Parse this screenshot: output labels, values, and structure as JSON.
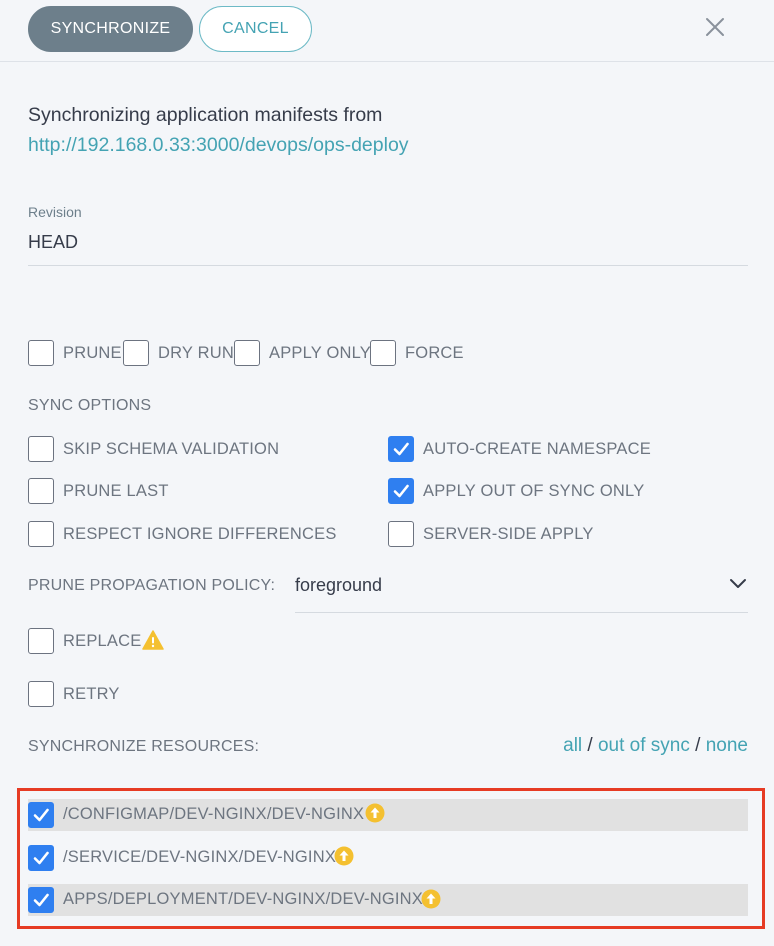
{
  "toolbar": {
    "synchronize_label": "SYNCHRONIZE",
    "cancel_label": "CANCEL",
    "close_icon": "close-icon"
  },
  "intro": {
    "text": "Synchronizing application manifests from",
    "repo_url": "http://192.168.0.33:3000/devops/ops-deploy"
  },
  "revision": {
    "label": "Revision",
    "value": "HEAD"
  },
  "options": {
    "prune": {
      "label": "PRUNE",
      "checked": false
    },
    "dry_run": {
      "label": "DRY RUN",
      "checked": false
    },
    "apply_only": {
      "label": "APPLY ONLY",
      "checked": false
    },
    "force": {
      "label": "FORCE",
      "checked": false
    }
  },
  "sync_options": {
    "title": "SYNC OPTIONS",
    "skip_schema_validation": {
      "label": "SKIP SCHEMA VALIDATION",
      "checked": false
    },
    "auto_create_namespace": {
      "label": "AUTO-CREATE NAMESPACE",
      "checked": true
    },
    "prune_last": {
      "label": "PRUNE LAST",
      "checked": false
    },
    "apply_out_of_sync_only": {
      "label": "APPLY OUT OF SYNC ONLY",
      "checked": true
    },
    "respect_ignore_differences": {
      "label": "RESPECT IGNORE DIFFERENCES",
      "checked": false
    },
    "server_side_apply": {
      "label": "SERVER-SIDE APPLY",
      "checked": false
    }
  },
  "prune_propagation": {
    "label": "PRUNE PROPAGATION POLICY:",
    "value": "foreground"
  },
  "replace": {
    "label": "REPLACE",
    "checked": false,
    "icon": "warning-icon"
  },
  "retry": {
    "label": "RETRY",
    "checked": false
  },
  "resources": {
    "title": "SYNCHRONIZE RESOURCES:",
    "link_all": "all",
    "link_out_of_sync": "out of sync",
    "link_none": "none",
    "separator": "/",
    "items": [
      {
        "label": "/CONFIGMAP/DEV-NGINX/DEV-NGINX",
        "checked": true,
        "icon": "out-of-sync-arrow-icon"
      },
      {
        "label": "/SERVICE/DEV-NGINX/DEV-NGINX",
        "checked": true,
        "icon": "out-of-sync-arrow-icon"
      },
      {
        "label": "APPS/DEPLOYMENT/DEV-NGINX/DEV-NGINX",
        "checked": true,
        "icon": "out-of-sync-arrow-icon"
      }
    ]
  },
  "colors": {
    "accent": "#44a3b3",
    "checkbox_checked": "#2f7ff0",
    "highlight_border": "#e63b24",
    "warning": "#f4c030"
  }
}
